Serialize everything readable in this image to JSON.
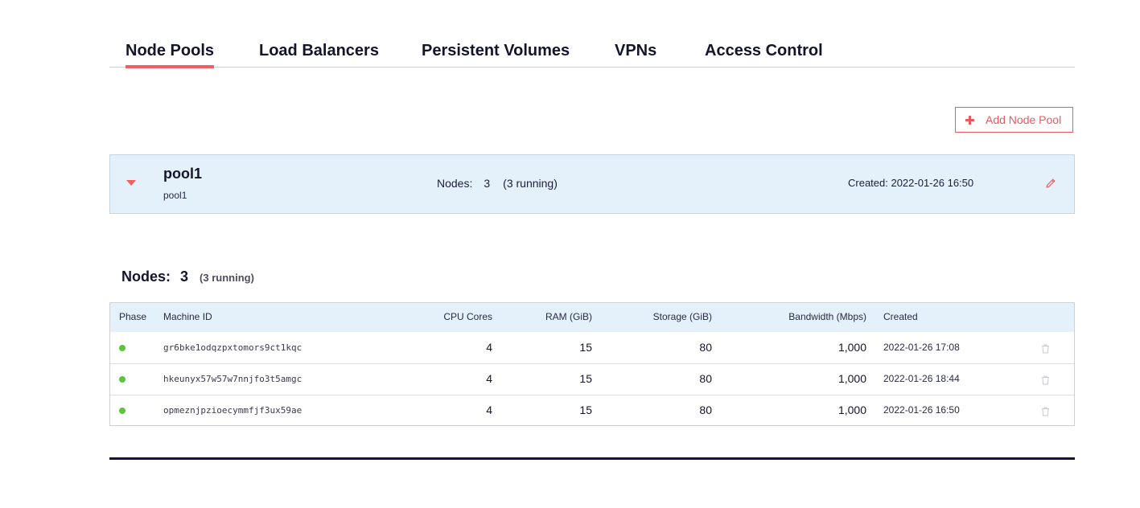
{
  "tabs": [
    {
      "label": "Node Pools",
      "active": true
    },
    {
      "label": "Load Balancers",
      "active": false
    },
    {
      "label": "Persistent Volumes",
      "active": false
    },
    {
      "label": "VPNs",
      "active": false
    },
    {
      "label": "Access Control",
      "active": false
    }
  ],
  "actions": {
    "add_pool_label": "Add Node Pool",
    "add_icon": "plus-icon"
  },
  "pool": {
    "name": "pool1",
    "subtitle": "pool1",
    "nodes_label": "Nodes:",
    "nodes_count": "3",
    "nodes_running": "(3 running)",
    "created": "Created: 2022-01-26 16:50",
    "toggle_icon": "caret-down-icon",
    "edit_icon": "pencil-icon"
  },
  "nodes_summary": {
    "label": "Nodes:",
    "count": "3",
    "running": "(3 running)"
  },
  "table": {
    "columns": [
      "Phase",
      "Machine ID",
      "CPU Cores",
      "RAM (GiB)",
      "Storage (GiB)",
      "Bandwidth (Mbps)",
      "Created"
    ],
    "rows": [
      {
        "phase": "running",
        "machine_id": "gr6bke1odqzpxtomors9ct1kqc",
        "cpu": "4",
        "ram": "15",
        "storage": "80",
        "bandwidth": "1,000",
        "created": "2022-01-26 17:08"
      },
      {
        "phase": "running",
        "machine_id": "hkeunyx57w57w7nnjfo3t5amgc",
        "cpu": "4",
        "ram": "15",
        "storage": "80",
        "bandwidth": "1,000",
        "created": "2022-01-26 18:44"
      },
      {
        "phase": "running",
        "machine_id": "opmeznjpzioecymmfjf3ux59ae",
        "cpu": "4",
        "ram": "15",
        "storage": "80",
        "bandwidth": "1,000",
        "created": "2022-01-26 16:50"
      }
    ],
    "delete_icon": "trash-icon"
  },
  "colors": {
    "accent": "#ef6060",
    "panel_bg": "#e5f1fa",
    "status_running": "#5cc43a",
    "text_dark": "#14142b"
  }
}
